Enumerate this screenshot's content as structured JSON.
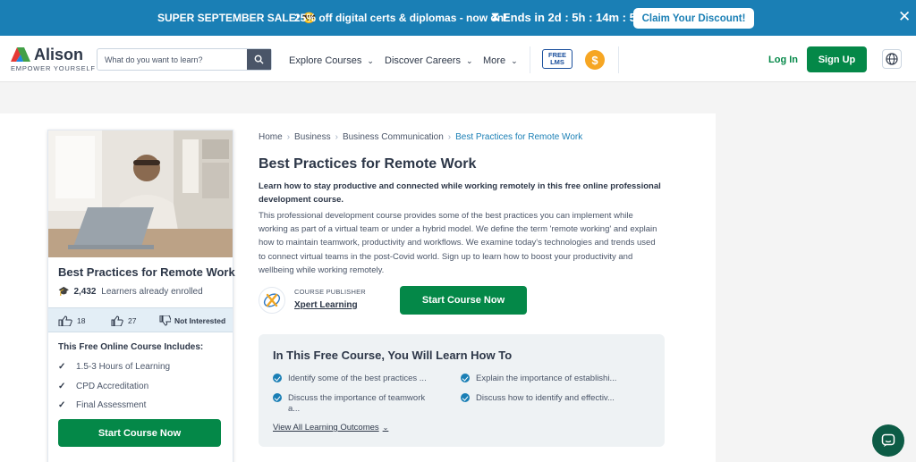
{
  "promo": {
    "sale_label": "SUPER SEPTEMBER SALE! 😎",
    "offer": "25% off digital certs & diplomas - now on!",
    "countdown": "Ends in 2d : 5h : 14m : 57s",
    "claim_label": "Claim Your Discount!",
    "close_icon": "close-icon",
    "background": "#1a7fb5"
  },
  "header": {
    "logo_name": "Alison",
    "logo_tagline": "EMPOWER YOURSELF",
    "search_placeholder": "What do you want to learn?",
    "nav": {
      "explore": "Explore Courses",
      "careers": "Discover Careers",
      "more": "More"
    },
    "lms_badge_line1": "FREE",
    "lms_badge_line2": "LMS",
    "coin_symbol": "$",
    "login_label": "Log In",
    "signup_label": "Sign Up",
    "accent": "#048848"
  },
  "course_card": {
    "title": "Best Practices for Remote Work",
    "enrolled_count": "2,432",
    "enrolled_text": "Learners already enrolled",
    "likes": "18",
    "shares": "27",
    "not_interested": "Not Interested",
    "includes_title": "This Free Online Course Includes:",
    "includes": [
      "1.5-3 Hours of Learning",
      "CPD Accreditation",
      "Final Assessment"
    ],
    "start_label": "Start Course Now"
  },
  "breadcrumb": {
    "items": [
      "Home",
      "Business",
      "Business Communication"
    ],
    "current": "Best Practices for Remote Work"
  },
  "course": {
    "title": "Best Practices for Remote Work",
    "subtitle": "Learn how to stay productive and connected while working remotely in this free online professional development course.",
    "description": "This professional development course provides some of the best practices you can implement while working as part of a virtual team or under a hybrid model. We define the term 'remote working' and explain how to maintain teamwork, productivity and workflows. We examine today's technologies and trends used to connect virtual teams in the post-Covid world. Sign up to learn how to boost your productivity and wellbeing while working remotely.",
    "publisher_label": "COURSE PUBLISHER",
    "publisher_name": "Xpert Learning",
    "start_label": "Start Course Now"
  },
  "outcomes": {
    "title": "In This Free Course, You Will Learn How To",
    "items": [
      "Identify some of the best practices ...",
      "Explain the importance of establishi...",
      "Discuss the importance of teamwork",
      "a...",
      "Discuss how to identify and effectiv..."
    ],
    "view_all_label": "View All Learning Outcomes"
  }
}
